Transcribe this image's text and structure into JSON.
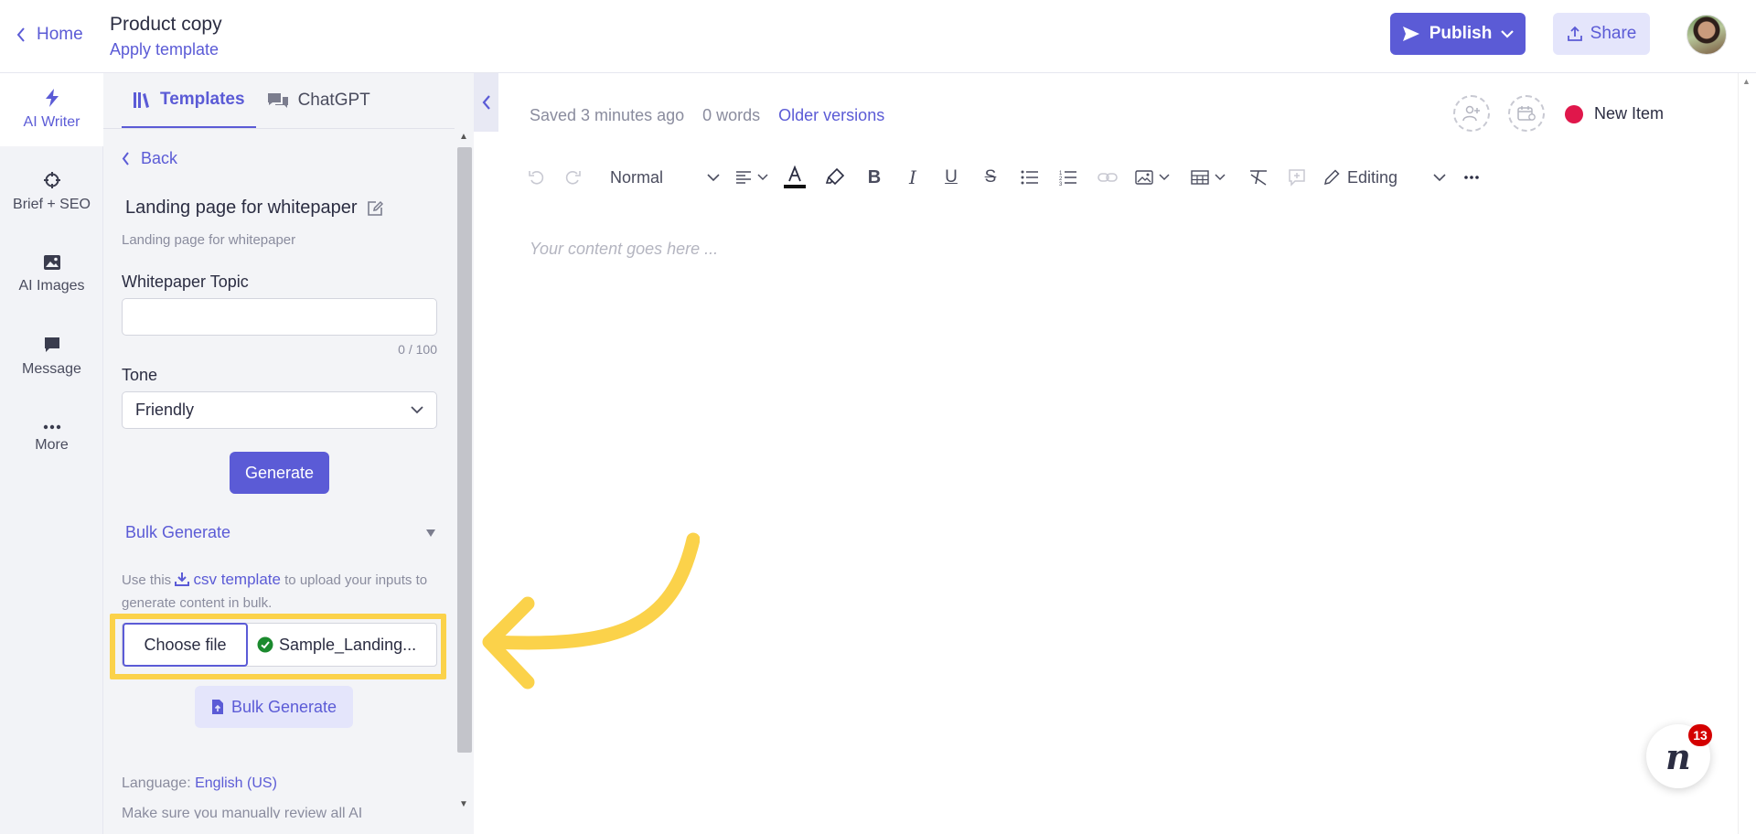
{
  "header": {
    "home_label": "Home",
    "doc_title": "Product copy",
    "doc_subtitle": "Apply template",
    "publish_label": "Publish",
    "share_label": "Share"
  },
  "rail": {
    "items": [
      {
        "label": "AI Writer",
        "icon": "bolt-icon"
      },
      {
        "label": "Brief + SEO",
        "icon": "crosshair-icon"
      },
      {
        "label": "AI Images",
        "icon": "image-icon"
      },
      {
        "label": "Message",
        "icon": "chat-bubble-icon"
      },
      {
        "label": "More",
        "icon": "more-dots-icon"
      }
    ]
  },
  "panel": {
    "tabs": [
      {
        "label": "Templates",
        "active": true
      },
      {
        "label": "ChatGPT",
        "active": false
      }
    ],
    "back_label": "Back",
    "template_title": "Landing page for whitepaper",
    "template_desc": "Landing page for whitepaper",
    "topic_label": "Whitepaper Topic",
    "topic_value": "",
    "topic_counter": "0 / 100",
    "tone_label": "Tone",
    "tone_value": "Friendly",
    "generate_label": "Generate",
    "bulk_generate_header": "Bulk Generate",
    "bulk_help_prefix": "Use this",
    "bulk_help_link": "csv template",
    "bulk_help_suffix": "to upload your inputs to generate content in bulk.",
    "choose_file_label": "Choose file",
    "file_name": "Sample_Landing...",
    "bulk_generate_button": "Bulk Generate",
    "language_prefix": "Language:",
    "language_value": "English (US)",
    "review_note": "Make sure you manually review all AI"
  },
  "editor": {
    "saved_text": "Saved 3 minutes ago",
    "word_count": "0 words",
    "older_versions": "Older versions",
    "status_label": "New Item",
    "status_color": "#e0174b",
    "text_style": "Normal",
    "mode": "Editing",
    "placeholder": "Your content goes here ..."
  },
  "chat_widget": {
    "letter": "n",
    "count": "13"
  },
  "colors": {
    "accent": "#5b5bd6",
    "highlight": "#fbd24a"
  }
}
